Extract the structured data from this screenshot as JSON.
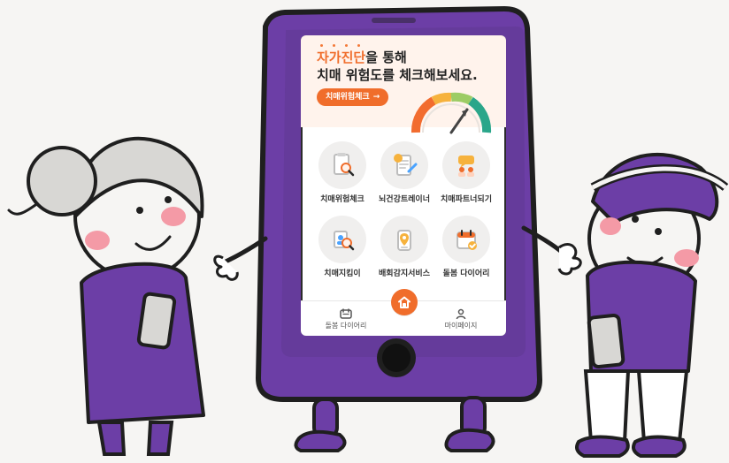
{
  "hero": {
    "title_accent": "자가진단",
    "title_rest": "을 통해",
    "subtitle": "치매 위험도를 체크해보세요.",
    "cta_label": "치매위험체크",
    "cta_arrow": "→"
  },
  "features": [
    {
      "label": "치매위험체크",
      "icon": "clipboard-magnifier-icon"
    },
    {
      "label": "뇌건강트레이너",
      "icon": "notebook-pen-icon"
    },
    {
      "label": "치매파트너되기",
      "icon": "community-icon"
    },
    {
      "label": "치매지킴이",
      "icon": "profile-search-icon"
    },
    {
      "label": "배회감지서비스",
      "icon": "location-pin-phone-icon"
    },
    {
      "label": "돌봄 다이어리",
      "icon": "calendar-check-icon"
    }
  ],
  "tabbar": {
    "left_label": "돌봄 다이어리",
    "right_label": "마이페이지",
    "left_icon": "calendar-icon",
    "home_icon": "home-icon",
    "right_icon": "user-icon"
  },
  "colors": {
    "accent": "#f06d2b",
    "purple": "#6c3ea6",
    "phone_dark": "#2b2b2b",
    "hero_bg": "#fff3ec"
  }
}
